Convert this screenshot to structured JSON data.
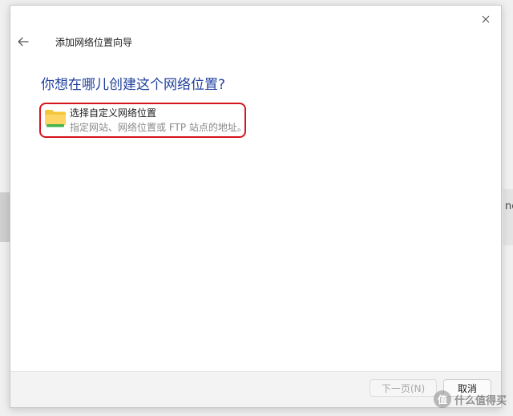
{
  "dialog": {
    "title": "添加网络位置向导",
    "question": "你想在哪儿创建这个网络位置?",
    "close_icon": "close-icon",
    "back_icon": "back-arrow-icon"
  },
  "option": {
    "title": "选择自定义网络位置",
    "description": "指定网站、网络位置或 FTP 站点的地址。",
    "icon": "folder-icon",
    "highlight_color": "#d6141b"
  },
  "footer": {
    "next_label": "下一页(N)",
    "cancel_label": "取消"
  },
  "background": {
    "partial_text": "ne"
  },
  "watermark": {
    "logo_char": "值",
    "text": "什么值得买"
  },
  "colors": {
    "question_text": "#1f3f9e",
    "highlight": "#d6141b",
    "disabled_text": "#a8a8a8"
  }
}
